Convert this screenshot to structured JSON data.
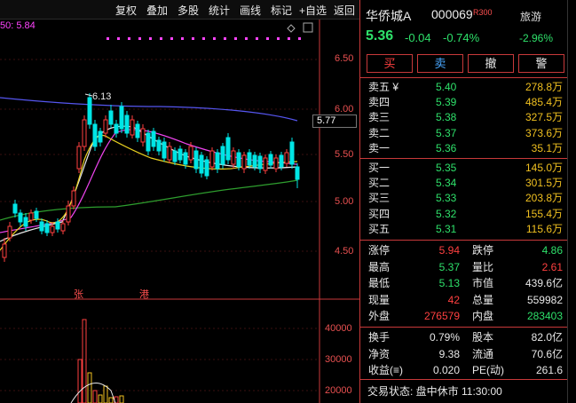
{
  "toolbar": {
    "items": [
      "复权",
      "叠加",
      "多股",
      "统计",
      "画线",
      "标记",
      "+自选",
      "返回"
    ]
  },
  "ma_legend": "50: 5.84",
  "price_axis": [
    "6.50",
    "6.00",
    "5.50",
    "5.00",
    "4.50"
  ],
  "volume_axis": [
    "40000",
    "30000",
    "20000"
  ],
  "current_price_tag": "5.77",
  "high_marker": "6.13",
  "annotations": [
    "张",
    "港"
  ],
  "stock": {
    "name": "华侨城A",
    "code": "000069",
    "index_tag": "R300",
    "price": "5.36",
    "change": "-0.04",
    "change_pct": "-0.74%",
    "sector": "旅游",
    "sector_pct": "-2.96%"
  },
  "trade_buttons": [
    "买",
    "卖",
    "撤",
    "警"
  ],
  "sell_orders": [
    {
      "label": "卖五 ¥",
      "price": "5.40",
      "vol": "278.8万"
    },
    {
      "label": "卖四",
      "price": "5.39",
      "vol": "485.4万"
    },
    {
      "label": "卖三",
      "price": "5.38",
      "vol": "327.5万"
    },
    {
      "label": "卖二",
      "price": "5.37",
      "vol": "373.6万"
    },
    {
      "label": "卖一",
      "price": "5.36",
      "vol": "35.1万"
    }
  ],
  "buy_orders": [
    {
      "label": "买一",
      "price": "5.35",
      "vol": "145.0万"
    },
    {
      "label": "买二",
      "price": "5.34",
      "vol": "301.5万"
    },
    {
      "label": "买三",
      "price": "5.33",
      "vol": "203.8万"
    },
    {
      "label": "买四",
      "price": "5.32",
      "vol": "155.4万"
    },
    {
      "label": "买五",
      "price": "5.31",
      "vol": "115.6万"
    }
  ],
  "stats": [
    {
      "l1": "涨停",
      "v1": "5.94",
      "c1": "#ff4040",
      "l2": "跌停",
      "v2": "4.86",
      "c2": "#2ee06a"
    },
    {
      "l1": "最高",
      "v1": "5.37",
      "c1": "#2ee06a",
      "l2": "量比",
      "v2": "2.61",
      "c2": "#ff4040"
    },
    {
      "l1": "最低",
      "v1": "5.13",
      "c1": "#2ee06a",
      "l2": "市值",
      "v2": "439.6亿",
      "c2": "#e8e8e8"
    },
    {
      "l1": "现量",
      "v1": "42",
      "c1": "#ff4040",
      "l2": "总量",
      "v2": "559982",
      "c2": "#e8e8e8"
    },
    {
      "l1": "外盘",
      "v1": "276579",
      "c1": "#ff4040",
      "l2": "内盘",
      "v2": "283403",
      "c2": "#2ee06a"
    }
  ],
  "stats2": [
    {
      "l1": "换手",
      "v1": "0.79%",
      "l2": "股本",
      "v2": "82.0亿"
    },
    {
      "l1": "净资",
      "v1": "9.38",
      "l2": "流通",
      "v2": "70.6亿"
    },
    {
      "l1": "收益(≡)",
      "v1": "0.020",
      "l2": "PE(动)",
      "v2": "261.6"
    }
  ],
  "status": "交易状态: 盘中休市 11:30:00",
  "colors": {
    "up": "#ff4040",
    "down": "#2ee06a",
    "cyan": "#00e5e5",
    "border": "#c8393a",
    "volume_yellow": "#f0c020"
  }
}
